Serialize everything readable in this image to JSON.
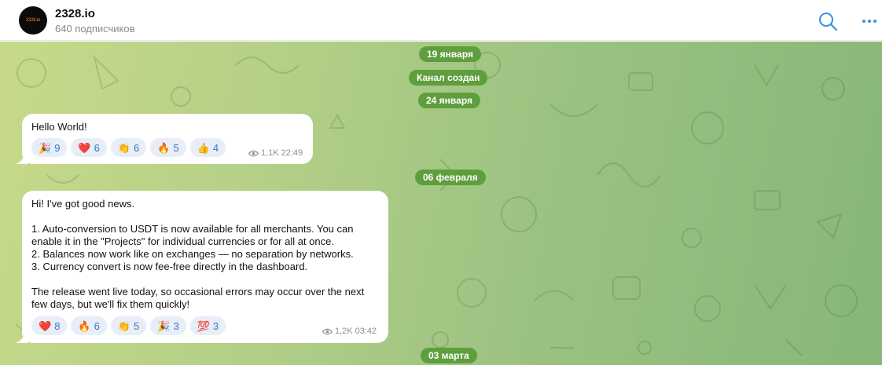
{
  "channel": {
    "name": "2328.io",
    "avatar_text": "2328.io",
    "subscribers": "640 подписчиков"
  },
  "header_icons": {
    "search": "search-icon",
    "more": "more-vertical-icon"
  },
  "colors": {
    "accent": "#3a74c7",
    "date_pill": "#5f9e3d",
    "bubble": "#ffffff"
  },
  "date_pills": {
    "jan19": "19 января",
    "channel_created": "Канал создан",
    "jan24": "24 января",
    "feb06": "06 февраля",
    "mar03": "03 марта"
  },
  "messages": [
    {
      "text": "Hello World!",
      "reactions": [
        {
          "emoji": "🎉",
          "count": "9"
        },
        {
          "emoji": "❤️",
          "count": "6"
        },
        {
          "emoji": "👏",
          "count": "6"
        },
        {
          "emoji": "🔥",
          "count": "5"
        },
        {
          "emoji": "👍",
          "count": "4"
        }
      ],
      "views": "1,1K",
      "time": "22:49"
    },
    {
      "text": "Hi! I've got good news.\n\n1. Auto-conversion to USDT is now available for all merchants. You can enable it in the \"Projects\" for individual currencies or for all at once.\n2. Balances now work like on exchanges — no separation by networks.\n3. Currency convert is now fee-free directly in the dashboard.\n\nThe release went live today, so occasional errors may occur over the next few days, but we'll fix them quickly!",
      "reactions": [
        {
          "emoji": "❤️",
          "count": "8"
        },
        {
          "emoji": "🔥",
          "count": "6"
        },
        {
          "emoji": "👏",
          "count": "5"
        },
        {
          "emoji": "🎉",
          "count": "3"
        },
        {
          "emoji": "💯",
          "count": "3"
        }
      ],
      "views": "1,2K",
      "time": "03:42"
    }
  ]
}
